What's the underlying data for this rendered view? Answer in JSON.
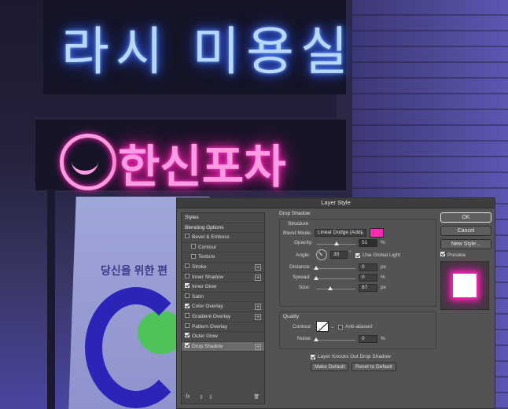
{
  "background": {
    "sign_blue_text": "라시 미용실",
    "sign_pink_text": "한신포차",
    "poster_text": "당신을 위한 편",
    "poster_letter": "C"
  },
  "dialog": {
    "title": "Layer Style",
    "styles_panel": {
      "items": [
        {
          "label": "Styles",
          "type": "head"
        },
        {
          "label": "Blending Options",
          "type": "head"
        },
        {
          "label": "Bevel & Emboss",
          "checked": false
        },
        {
          "label": "Contour",
          "checked": false,
          "sub": true
        },
        {
          "label": "Texture",
          "checked": false,
          "sub": true
        },
        {
          "label": "Stroke",
          "checked": false,
          "plus": true
        },
        {
          "label": "Inner Shadow",
          "checked": false,
          "plus": true
        },
        {
          "label": "Inner Glow",
          "checked": true
        },
        {
          "label": "Satin",
          "checked": false
        },
        {
          "label": "Color Overlay",
          "checked": true,
          "plus": true
        },
        {
          "label": "Gradient Overlay",
          "checked": false,
          "plus": true
        },
        {
          "label": "Pattern Overlay",
          "checked": false
        },
        {
          "label": "Outer Glow",
          "checked": true
        },
        {
          "label": "Drop Shadow",
          "checked": true,
          "plus": true,
          "active": true
        }
      ],
      "footer": {
        "fx": "fx",
        "up": "⇧",
        "down": "⇩",
        "trash": "🗑"
      }
    },
    "drop_shadow": {
      "title": "Drop Shadow",
      "structure_title": "Structure",
      "blend_mode_label": "Blend Mode:",
      "blend_mode_value": "Linear Dodge (Add)",
      "shadow_color": "#ff2ab6",
      "opacity_label": "Opacity:",
      "opacity_value": "51",
      "opacity_level": 0.51,
      "angle_label": "Angle:",
      "angle_value": "30",
      "degree_symbol": "°",
      "use_global_light_label": "Use Global Light",
      "use_global_light": true,
      "distance_label": "Distance:",
      "distance_value": "0",
      "distance_level": 0,
      "spread_label": "Spread:",
      "spread_value": "0",
      "spread_level": 0,
      "size_label": "Size:",
      "size_value": "87",
      "size_level": 0.35,
      "unit_px": "px",
      "unit_pct": "%",
      "quality_title": "Quality",
      "contour_label": "Contour:",
      "anti_aliased_label": "Anti-aliased",
      "anti_aliased": false,
      "noise_label": "Noise:",
      "noise_value": "0",
      "noise_level": 0,
      "knockout_label": "Layer Knocks Out Drop Shadow",
      "knockout": true,
      "make_default_label": "Make Default",
      "reset_default_label": "Reset to Default"
    },
    "buttons": {
      "ok": "OK",
      "cancel": "Cancel",
      "new_style": "New Style...",
      "preview_label": "Preview",
      "preview_checked": true
    }
  }
}
